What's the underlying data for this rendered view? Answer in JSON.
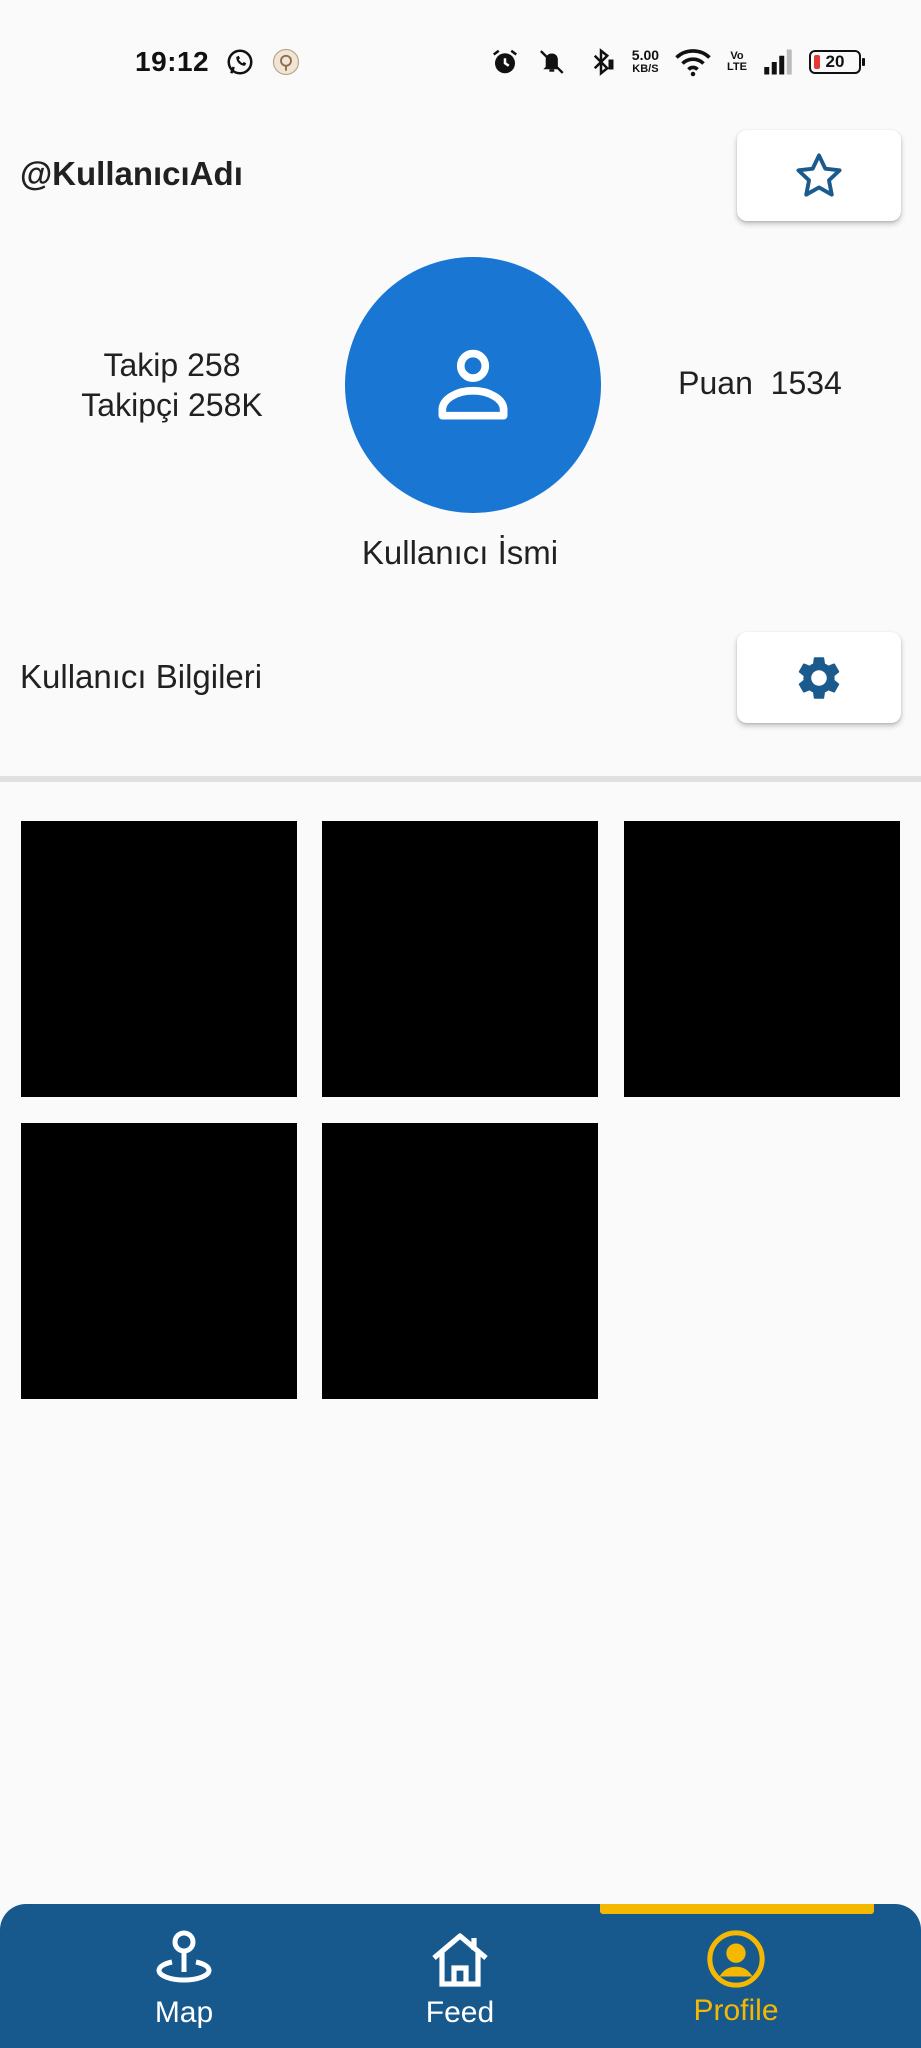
{
  "status_bar": {
    "time": "19:12",
    "net_speed_value": "5.00",
    "net_speed_unit": "KB/S",
    "volte_top": "Vo",
    "volte_bottom": "LTE",
    "battery": "20"
  },
  "header": {
    "username": "@KullanıcıAdı"
  },
  "profile": {
    "following": "Takip 258",
    "followers": "Takipçi 258K",
    "score": "Puan  1534",
    "display_name": "Kullanıcı İsmi",
    "info_label": "Kullanıcı Bilgileri"
  },
  "posts": {
    "count": 5
  },
  "bottom_nav": {
    "items": [
      {
        "label": "Map",
        "icon": "map-pin-icon"
      },
      {
        "label": "Feed",
        "icon": "home-icon"
      },
      {
        "label": "Profile",
        "icon": "account-circle-icon"
      }
    ],
    "active_index": 2
  },
  "colors": {
    "accent": "#1976d2",
    "nav_background": "#17588d",
    "nav_active": "#f5b800",
    "icon_blue": "#1a5a8c"
  }
}
